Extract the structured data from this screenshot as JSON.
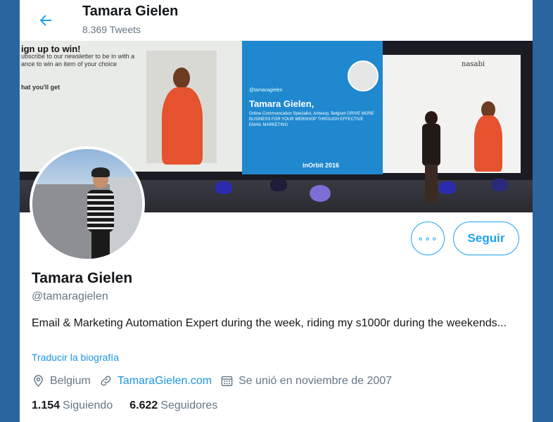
{
  "header": {
    "title": "Tamara Gielen",
    "tweet_count": "8.369 Tweets"
  },
  "banner": {
    "left_screen_title": "ign up to win!",
    "left_screen_lines": [
      "ubscribe to our newsletter to be in with a",
      "ance to win an item of your choice",
      "hat you'll get"
    ],
    "mid_handle": "@tamaragielen",
    "mid_name": "Tamara Gielen,",
    "mid_subtitle": "Online Communication Specialist, Antwerp, Belgium DRIVE MORE BUSINESS FOR YOUR WEBSHOP THROUGH EFFECTIVE EMAIL MARKETING",
    "mid_event": "inOrbit 2016",
    "right_logo": "nasabi"
  },
  "actions": {
    "more_label": "∘∘∘",
    "follow_label": "Seguir"
  },
  "profile": {
    "name": "Tamara Gielen",
    "handle": "@tamaragielen",
    "bio": "Email & Marketing Automation Expert during the week, riding my s1000r during the weekends...",
    "translate": "Traducir la biografía",
    "location": "Belgium",
    "website": "TamaraGielen.com",
    "joined": "Se unió en noviembre de 2007"
  },
  "stats": {
    "following_count": "1.154",
    "following_label": "Siguiendo",
    "followers_count": "6.622",
    "followers_label": "Seguidores"
  },
  "colors": {
    "accent": "#1da1f2",
    "link": "#1b95e0",
    "secondary_text": "#657786",
    "page_background": "#2a65a0"
  },
  "icons": [
    "back-arrow-icon",
    "location-pin-icon",
    "link-icon",
    "calendar-icon"
  ]
}
